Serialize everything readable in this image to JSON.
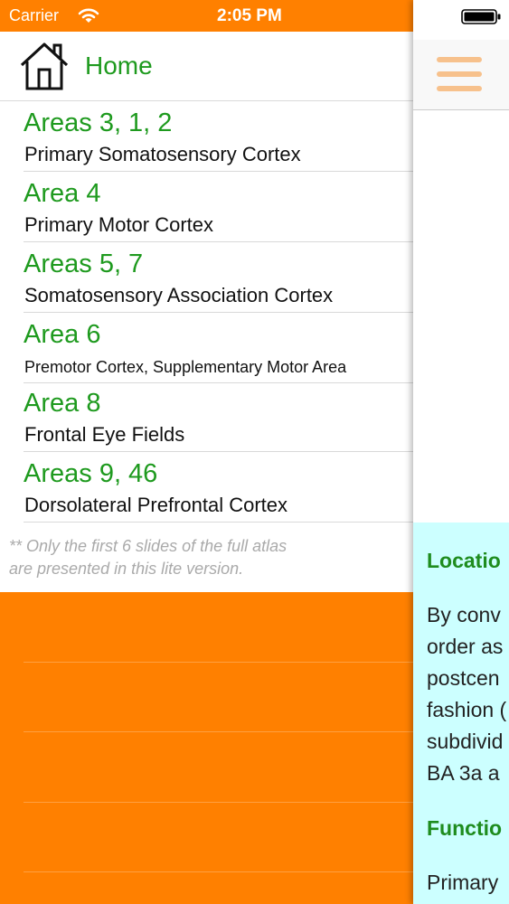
{
  "status_bar": {
    "carrier": "Carrier",
    "time": "2:05 PM"
  },
  "menu": {
    "home_label": "Home",
    "items": [
      {
        "title": "Areas 3, 1, 2",
        "subtitle": "Primary Somatosensory Cortex"
      },
      {
        "title": "Area 4",
        "subtitle": "Primary Motor Cortex"
      },
      {
        "title": "Areas 5, 7",
        "subtitle": "Somatosensory Association Cortex"
      },
      {
        "title": "Area 6",
        "subtitle": "Premotor Cortex, Supplementary Motor Area"
      },
      {
        "title": "Area 8",
        "subtitle": "Frontal Eye Fields"
      },
      {
        "title": "Areas 9, 46",
        "subtitle": "Dorsolateral Prefrontal Cortex"
      }
    ],
    "footnote_line1": "** Only the first 6 slides of the full atlas",
    "footnote_line2": "are presented in this lite version."
  },
  "content": {
    "location_heading": "Locatio",
    "location_lines": [
      "By conv",
      "order as",
      "postcen",
      "fashion (",
      "subdivid",
      "BA 3a a"
    ],
    "function_heading": "Functio",
    "function_line": "Primary"
  },
  "colors": {
    "accent_orange": "#ff8000",
    "title_green": "#1e9a1e",
    "info_background": "#ccffff",
    "menu_icon": "#f7c18c"
  },
  "icons": [
    "wifi-icon",
    "home-icon",
    "battery-icon",
    "hamburger-menu-icon"
  ]
}
